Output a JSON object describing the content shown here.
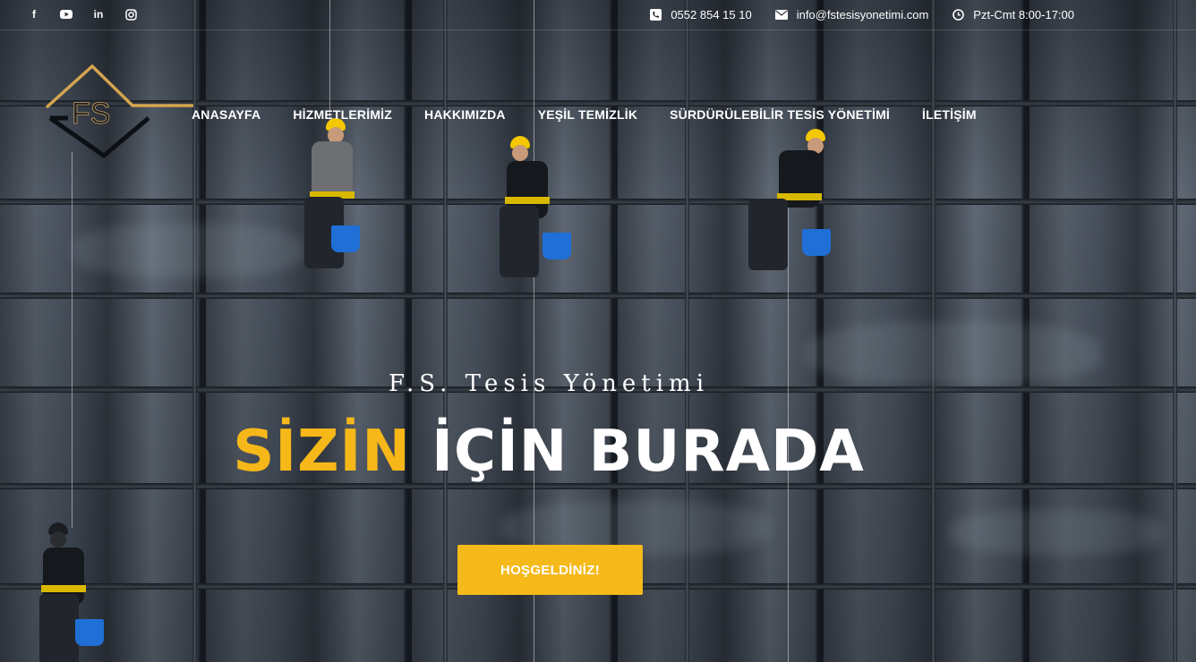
{
  "topbar": {
    "social": [
      {
        "icon": "facebook-icon",
        "glyph": "f"
      },
      {
        "icon": "youtube-icon",
        "glyph": "▶"
      },
      {
        "icon": "linkedin-icon",
        "glyph": "in"
      },
      {
        "icon": "instagram-icon",
        "glyph": "◎"
      }
    ],
    "phone": "0552 854 15 10",
    "email": "info@fstesisyonetimi.com",
    "hours": "Pzt-Cmt 8:00-17:00"
  },
  "logo": {
    "text": "FS"
  },
  "nav": {
    "items": [
      "ANASAYFA",
      "HİZMETLERİMİZ",
      "HAKKIMIZDA",
      "YEŞİL TEMİZLİK",
      "SÜRDÜRÜLEBİLİR TESİS YÖNETİMİ",
      "İLETİŞİM"
    ]
  },
  "hero": {
    "tagline": "F.S. Tesis Yönetimi",
    "headline_accent": "SİZİN",
    "headline_rest": "İÇİN BURADA",
    "cta_label": "HOŞGELDİNİZ!"
  },
  "colors": {
    "accent": "#f5b919",
    "text": "#ffffff",
    "overlay": "#0a0e14"
  }
}
